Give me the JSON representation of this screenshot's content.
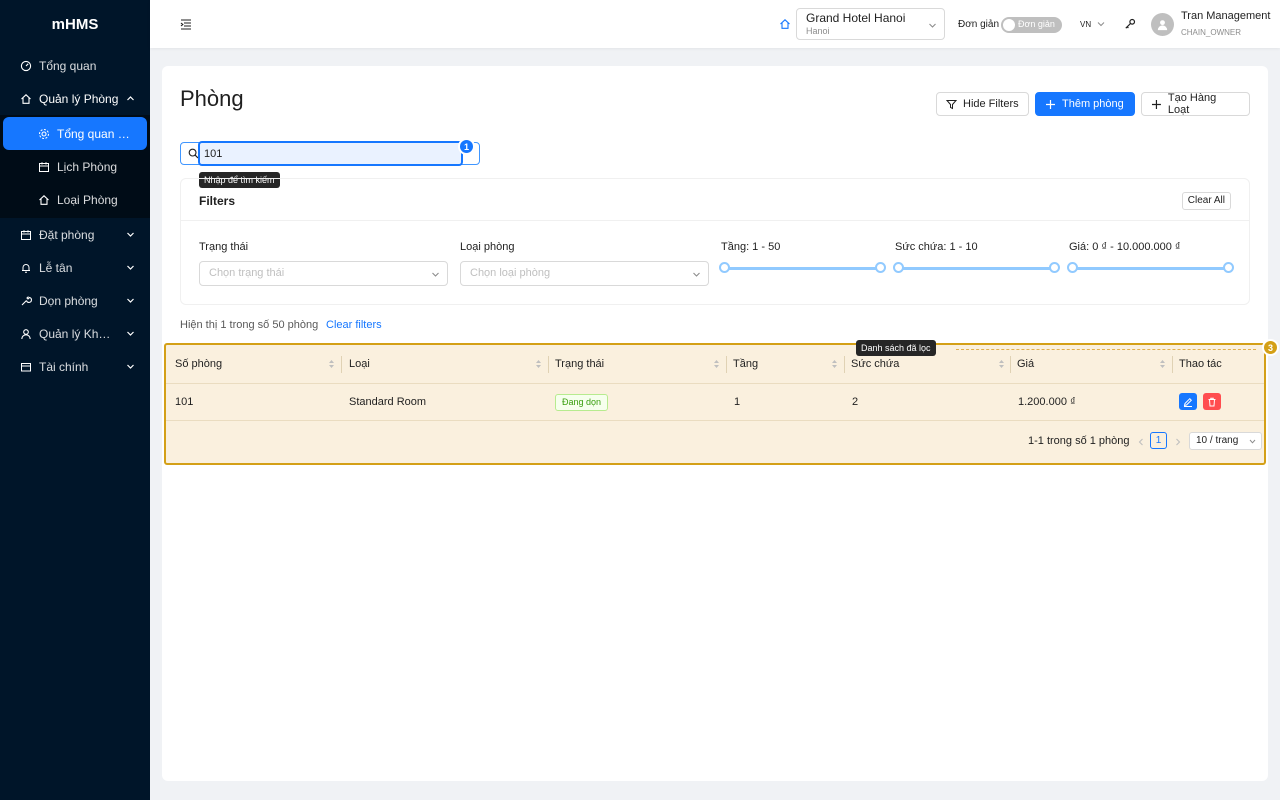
{
  "app": {
    "name": "mHMS"
  },
  "sidebar": {
    "items": [
      {
        "label": "Tổng quan",
        "icon": "dashboard-icon"
      },
      {
        "label": "Quản lý Phòng",
        "icon": "home-icon",
        "expanded": true,
        "children": [
          {
            "label": "Tổng quan Ph...",
            "icon": "gear-icon",
            "active": true
          },
          {
            "label": "Lịch Phòng",
            "icon": "calendar-icon"
          },
          {
            "label": "Loại Phòng",
            "icon": "home-icon"
          }
        ]
      },
      {
        "label": "Đặt phòng",
        "icon": "calendar-icon"
      },
      {
        "label": "Lễ tân",
        "icon": "bell-icon"
      },
      {
        "label": "Dọn phòng",
        "icon": "tool-icon"
      },
      {
        "label": "Quản lý Khách ...",
        "icon": "user-icon"
      },
      {
        "label": "Tài chính",
        "icon": "wallet-icon"
      }
    ]
  },
  "header": {
    "hotel_name": "Grand Hotel Hanoi",
    "hotel_city": "Hanoi",
    "mode_label": "Đơn giản",
    "switch_text": "Đơn giản",
    "language": "VN",
    "user_name": "Tran Management",
    "user_role": "CHAIN_OWNER"
  },
  "page": {
    "title": "Phòng",
    "hide_filters_label": "Hide Filters",
    "add_room_label": "Thêm phòng",
    "bulk_create_label": "Tạo Hàng Loạt",
    "search_value": "101",
    "search_tooltip": "Nhập để tìm kiếm",
    "marker_search": "1",
    "marker_table": "3",
    "table_tooltip": "Danh sách đã lọc"
  },
  "filters": {
    "title": "Filters",
    "clear_all": "Clear All",
    "status_label": "Trạng thái",
    "status_placeholder": "Chọn trạng thái",
    "type_label": "Loại phòng",
    "type_placeholder": "Chọn loại phòng",
    "floor_label": "Tầng: 1 - 50",
    "capacity_label": "Sức chứa: 1 - 10",
    "price_label": "Giá: 0 ₫ - 10.000.000 ₫"
  },
  "results": {
    "summary": "Hiện thị 1 trong số 50 phòng",
    "clear_filters": "Clear filters"
  },
  "table": {
    "columns": [
      "Số phòng",
      "Loại",
      "Trạng thái",
      "Tầng",
      "Sức chứa",
      "Giá",
      "Thao tác"
    ],
    "rows": [
      {
        "room": "101",
        "type": "Standard Room",
        "status": "Đang dọn",
        "floor": "1",
        "capacity": "2",
        "price": "1.200.000 ₫"
      }
    ],
    "pagination_text": "1-1 trong số 1 phòng",
    "current_page": "1",
    "page_size": "10 / trang"
  },
  "colors": {
    "primary": "#1677ff",
    "sidebar_bg": "#001529",
    "highlight": "#d4a017",
    "danger": "#ff4d4f"
  }
}
